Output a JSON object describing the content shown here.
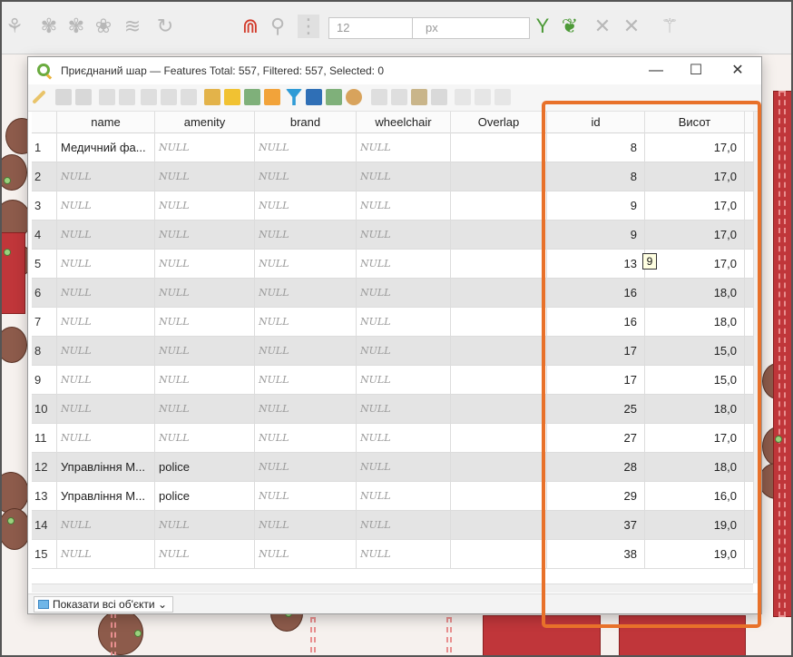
{
  "toolbar": {
    "font_size_value": "12",
    "unit_value": "px"
  },
  "dialog": {
    "title": "Приєднаний шар — Features Total: 557, Filtered: 557, Selected: 0",
    "minimize": "—",
    "maximize": "☐",
    "close": "✕"
  },
  "table": {
    "columns": [
      "name",
      "amenity",
      "brand",
      "wheelchair",
      "Overlap",
      "id",
      "Висот"
    ],
    "null_text": "NULL",
    "rows": [
      {
        "n": "1",
        "name": "Медичний фа...",
        "amenity": "NULL",
        "brand": "NULL",
        "wheelchair": "NULL",
        "overlap": "",
        "id": "8",
        "height": "17,0"
      },
      {
        "n": "2",
        "name": "NULL",
        "amenity": "NULL",
        "brand": "NULL",
        "wheelchair": "NULL",
        "overlap": "",
        "id": "8",
        "height": "17,0"
      },
      {
        "n": "3",
        "name": "NULL",
        "amenity": "NULL",
        "brand": "NULL",
        "wheelchair": "NULL",
        "overlap": "",
        "id": "9",
        "height": "17,0"
      },
      {
        "n": "4",
        "name": "NULL",
        "amenity": "NULL",
        "brand": "NULL",
        "wheelchair": "NULL",
        "overlap": "",
        "id": "9",
        "height": "17,0"
      },
      {
        "n": "5",
        "name": "NULL",
        "amenity": "NULL",
        "brand": "NULL",
        "wheelchair": "NULL",
        "overlap": "",
        "id": "13",
        "height": "17,0"
      },
      {
        "n": "6",
        "name": "NULL",
        "amenity": "NULL",
        "brand": "NULL",
        "wheelchair": "NULL",
        "overlap": "",
        "id": "16",
        "height": "18,0"
      },
      {
        "n": "7",
        "name": "NULL",
        "amenity": "NULL",
        "brand": "NULL",
        "wheelchair": "NULL",
        "overlap": "",
        "id": "16",
        "height": "18,0"
      },
      {
        "n": "8",
        "name": "NULL",
        "amenity": "NULL",
        "brand": "NULL",
        "wheelchair": "NULL",
        "overlap": "",
        "id": "17",
        "height": "15,0"
      },
      {
        "n": "9",
        "name": "NULL",
        "amenity": "NULL",
        "brand": "NULL",
        "wheelchair": "NULL",
        "overlap": "",
        "id": "17",
        "height": "15,0"
      },
      {
        "n": "10",
        "name": "NULL",
        "amenity": "NULL",
        "brand": "NULL",
        "wheelchair": "NULL",
        "overlap": "",
        "id": "25",
        "height": "18,0"
      },
      {
        "n": "11",
        "name": "NULL",
        "amenity": "NULL",
        "brand": "NULL",
        "wheelchair": "NULL",
        "overlap": "",
        "id": "27",
        "height": "17,0"
      },
      {
        "n": "12",
        "name": "Управління М...",
        "amenity": "police",
        "brand": "NULL",
        "wheelchair": "NULL",
        "overlap": "",
        "id": "28",
        "height": "18,0"
      },
      {
        "n": "13",
        "name": "Управління М...",
        "amenity": "police",
        "brand": "NULL",
        "wheelchair": "NULL",
        "overlap": "",
        "id": "29",
        "height": "16,0"
      },
      {
        "n": "14",
        "name": "NULL",
        "amenity": "NULL",
        "brand": "NULL",
        "wheelchair": "NULL",
        "overlap": "",
        "id": "37",
        "height": "19,0"
      },
      {
        "n": "15",
        "name": "NULL",
        "amenity": "NULL",
        "brand": "NULL",
        "wheelchair": "NULL",
        "overlap": "",
        "id": "38",
        "height": "19,0"
      }
    ]
  },
  "tooltip": "9",
  "status": {
    "show_all_label": "Показати всі об'єкти"
  }
}
